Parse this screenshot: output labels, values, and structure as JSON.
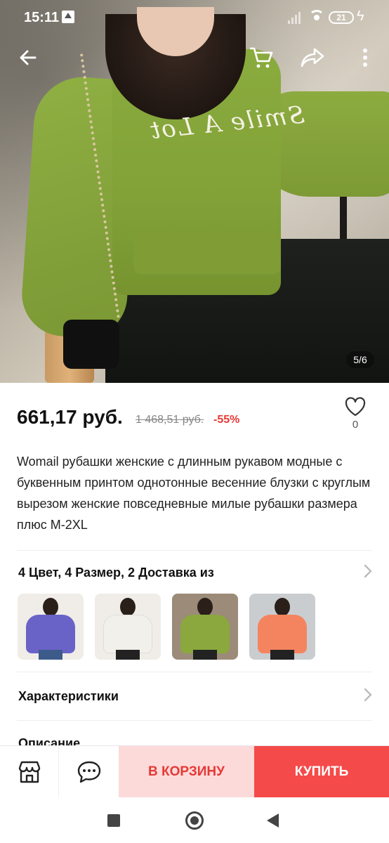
{
  "status_bar": {
    "time": "15:11",
    "battery": "21"
  },
  "gallery": {
    "counter": "5/6",
    "print_text": "Smile A Lot"
  },
  "product": {
    "price": "661,17 руб.",
    "old_price": "1 468,51 руб.",
    "discount": "-55%",
    "wishlist_count": "0",
    "title": "Womail рубашки женские с длинным рукавом модные с буквенным принтом однотонные весенние блузки с круглым вырезом женские повседневные милые рубашки размера плюс M-2XL"
  },
  "options": {
    "summary": "4 Цвет, 4 Размер, 2 Доставка из",
    "variants": [
      {
        "name": "purple",
        "color": "#6a63c7"
      },
      {
        "name": "white",
        "color": "#f2f0ea"
      },
      {
        "name": "green",
        "color": "#8aa83e"
      },
      {
        "name": "orange",
        "color": "#f4845f"
      }
    ]
  },
  "sections": {
    "specs": "Характеристики",
    "description": "Описание"
  },
  "actions": {
    "add_to_cart": "В КОРЗИНУ",
    "buy": "КУПИТЬ"
  },
  "colors": {
    "accent": "#f54a4a",
    "accent_light": "#fddada",
    "discount": "#e53935"
  }
}
